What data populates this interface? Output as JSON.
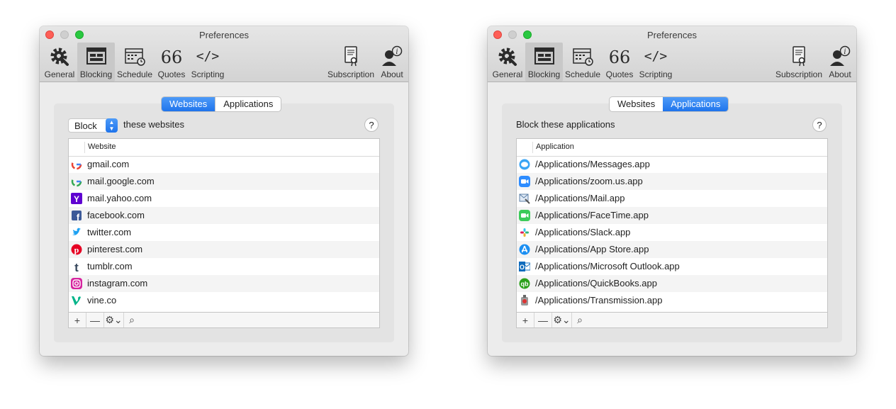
{
  "windows": [
    {
      "title": "Preferences",
      "toolbar": [
        {
          "label": "General",
          "icon": "gear-wrench-icon"
        },
        {
          "label": "Blocking",
          "icon": "blocked-window-icon",
          "active": true
        },
        {
          "label": "Schedule",
          "icon": "calendar-clock-icon"
        },
        {
          "label": "Quotes",
          "icon": "quote-icon",
          "glyph": "66"
        },
        {
          "label": "Scripting",
          "icon": "code-icon",
          "glyph": "</>"
        },
        {
          "label": "Subscription",
          "icon": "certificate-icon"
        },
        {
          "label": "About",
          "icon": "person-info-icon"
        }
      ],
      "tabs": [
        {
          "label": "Websites",
          "selected": true
        },
        {
          "label": "Applications",
          "selected": false
        }
      ],
      "mode_select": {
        "value": "Block"
      },
      "mode_suffix": "these websites",
      "help": "?",
      "column": "Website",
      "rows": [
        {
          "text": "gmail.com",
          "icon": "google-icon"
        },
        {
          "text": "mail.google.com",
          "icon": "google-icon"
        },
        {
          "text": "mail.yahoo.com",
          "icon": "yahoo-icon"
        },
        {
          "text": "facebook.com",
          "icon": "facebook-icon"
        },
        {
          "text": "twitter.com",
          "icon": "twitter-icon"
        },
        {
          "text": "pinterest.com",
          "icon": "pinterest-icon"
        },
        {
          "text": "tumblr.com",
          "icon": "tumblr-icon"
        },
        {
          "text": "instagram.com",
          "icon": "instagram-icon"
        },
        {
          "text": "vine.co",
          "icon": "vine-icon"
        }
      ],
      "footer": {
        "add": "+",
        "remove": "—",
        "gear": "⚙⌄",
        "search": "⌕"
      }
    },
    {
      "title": "Preferences",
      "toolbar": [
        {
          "label": "General",
          "icon": "gear-wrench-icon"
        },
        {
          "label": "Blocking",
          "icon": "blocked-window-icon",
          "active": true
        },
        {
          "label": "Schedule",
          "icon": "calendar-clock-icon"
        },
        {
          "label": "Quotes",
          "icon": "quote-icon",
          "glyph": "66"
        },
        {
          "label": "Scripting",
          "icon": "code-icon",
          "glyph": "</>"
        },
        {
          "label": "Subscription",
          "icon": "certificate-icon"
        },
        {
          "label": "About",
          "icon": "person-info-icon"
        }
      ],
      "tabs": [
        {
          "label": "Websites",
          "selected": false
        },
        {
          "label": "Applications",
          "selected": true
        }
      ],
      "header_text": "Block these applications",
      "help": "?",
      "column": "Application",
      "rows": [
        {
          "text": "/Applications/Messages.app",
          "icon": "messages-icon"
        },
        {
          "text": "/Applications/zoom.us.app",
          "icon": "zoom-icon"
        },
        {
          "text": "/Applications/Mail.app",
          "icon": "mail-icon"
        },
        {
          "text": "/Applications/FaceTime.app",
          "icon": "facetime-icon"
        },
        {
          "text": "/Applications/Slack.app",
          "icon": "slack-icon"
        },
        {
          "text": "/Applications/App Store.app",
          "icon": "app-store-icon"
        },
        {
          "text": "/Applications/Microsoft Outlook.app",
          "icon": "outlook-icon"
        },
        {
          "text": "/Applications/QuickBooks.app",
          "icon": "quickbooks-icon"
        },
        {
          "text": "/Applications/Transmission.app",
          "icon": "transmission-icon"
        }
      ],
      "footer": {
        "add": "+",
        "remove": "—",
        "gear": "⚙⌄",
        "search": "⌕"
      }
    }
  ],
  "colors": {
    "accent": "#1f74ec",
    "close": "#fe5f57",
    "maximize": "#29c840"
  }
}
